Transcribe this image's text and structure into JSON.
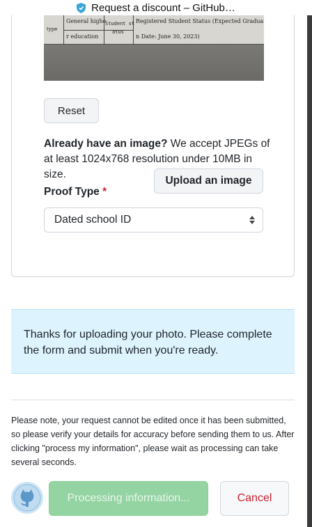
{
  "browser": {
    "title": "Request a discount – GitHub…",
    "icon": "shield-icon"
  },
  "photo": {
    "cells": {
      "type": "type",
      "general_higher": "General highe",
      "r_education": "r education",
      "student_st": "Student st",
      "atus": "atus",
      "registered_status": "Registered Student Status (Expected Graduatio",
      "date": "n Date: June 30, 2023)"
    }
  },
  "form": {
    "reset_label": "Reset",
    "upload_prompt_bold": "Already have an image?",
    "upload_prompt_text": " We accept JPEGs of at least 1024x768 resolution under 10MB in size.",
    "upload_button": "Upload an image",
    "proof_type_label": "Proof Type",
    "required_marker": "*",
    "proof_type_selected": "Dated school ID"
  },
  "flash": {
    "message": "Thanks for uploading your photo. Please complete the form and submit when you're ready."
  },
  "note": {
    "text": "Please note, your request cannot be edited once it has been submitted, so please verify your details for accuracy before sending them to us. After clicking \"process my information\", please wait as processing can take several seconds."
  },
  "actions": {
    "process_label": "Processing information...",
    "cancel_label": "Cancel"
  },
  "colors": {
    "accent_green_disabled": "#94d3a2",
    "danger": "#cf222e",
    "info_bg": "#ddf4ff"
  }
}
